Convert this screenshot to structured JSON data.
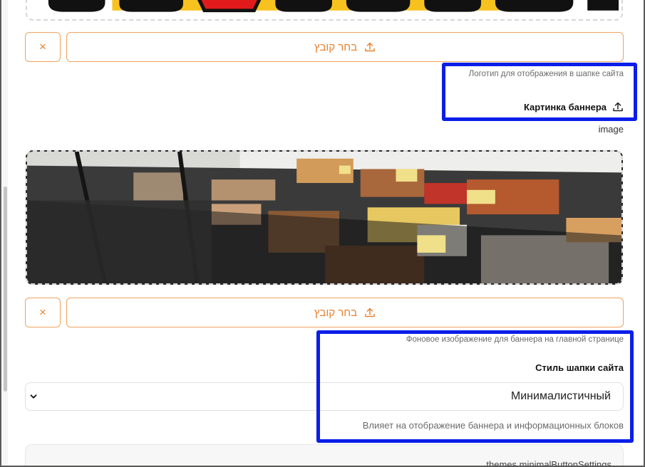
{
  "logo_upload": {
    "choose_label": "בחר קובץ",
    "remove_symbol": "×",
    "help": "Логотип для отображения в шапке сайта"
  },
  "banner": {
    "label": "Картинка баннера",
    "caption": "image",
    "choose_label": "בחר קובץ",
    "remove_symbol": "×",
    "help": "Фоновое изображение для баннера на главной странице"
  },
  "header_style": {
    "label": "Стиль шапки сайта",
    "selected": "Минималистичный",
    "help": "Влияет на отображение баннера и информационных блоков"
  },
  "next_section": {
    "title": "themes.minimalButtonSettings"
  },
  "icons": {
    "upload": "upload-icon",
    "close": "close-icon",
    "chevron": "chevron-down-icon"
  },
  "colors": {
    "accent": "#e8822f",
    "highlight": "#0a1ee8"
  }
}
